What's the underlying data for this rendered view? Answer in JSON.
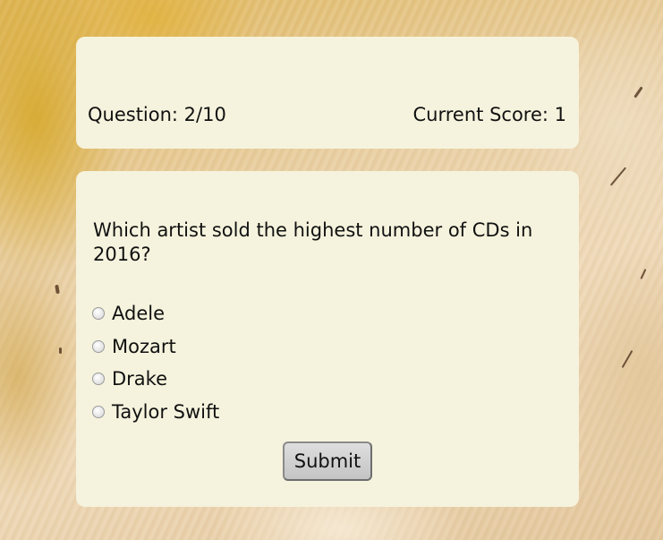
{
  "status": {
    "question_counter": "Question: 2/10",
    "current_score": "Current Score: 1"
  },
  "quiz": {
    "question": "Which artist sold the highest number of CDs in 2016?",
    "options": [
      "Adele",
      "Mozart",
      "Drake",
      "Taylor Swift"
    ],
    "submit_label": "Submit"
  },
  "colors": {
    "panel_background": "#f5f3dd",
    "page_background": "#e6c99e",
    "accent_yellow": "#d6a82a"
  }
}
